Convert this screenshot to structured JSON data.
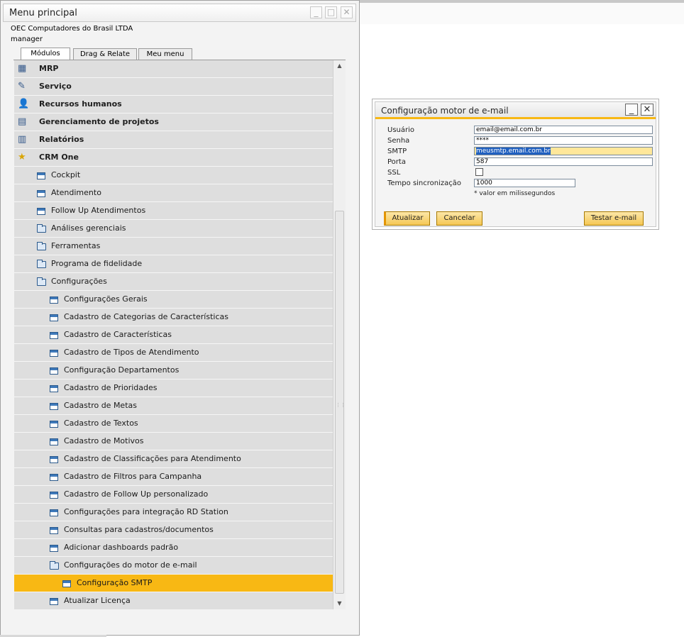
{
  "main_window": {
    "title": "Menu principal",
    "company": "OEC Computadores do Brasil LTDA",
    "user": "manager",
    "tabs": [
      {
        "label": "Módulos",
        "active": true
      },
      {
        "label": "Drag & Relate",
        "active": false
      },
      {
        "label": "Meu menu",
        "active": false
      }
    ],
    "controls": {
      "minimize": "_",
      "maximize": "□",
      "close": "✕"
    }
  },
  "tree": {
    "rows": [
      {
        "label": "MRP",
        "level": 0,
        "icon": "mrp-icon"
      },
      {
        "label": "Serviço",
        "level": 0,
        "icon": "service-icon"
      },
      {
        "label": "Recursos humanos",
        "level": 0,
        "icon": "human-resources-icon"
      },
      {
        "label": "Gerenciamento de projetos",
        "level": 0,
        "icon": "project-management-icon"
      },
      {
        "label": "Relatórios",
        "level": 0,
        "icon": "reports-icon"
      },
      {
        "label": "CRM One",
        "level": 0,
        "icon": "crm-one-icon"
      },
      {
        "label": "Cockpit",
        "level": 1,
        "icon": "window-icon"
      },
      {
        "label": "Atendimento",
        "level": 1,
        "icon": "window-icon"
      },
      {
        "label": "Follow Up Atendimentos",
        "level": 1,
        "icon": "window-icon"
      },
      {
        "label": "Análises gerenciais",
        "level": 1,
        "icon": "folder-icon"
      },
      {
        "label": "Ferramentas",
        "level": 1,
        "icon": "folder-icon"
      },
      {
        "label": "Programa de fidelidade",
        "level": 1,
        "icon": "folder-icon"
      },
      {
        "label": "Configurações",
        "level": 1,
        "icon": "folder-open-icon"
      },
      {
        "label": "Configurações Gerais",
        "level": 2,
        "icon": "window-icon"
      },
      {
        "label": "Cadastro de Categorias de Características",
        "level": 2,
        "icon": "window-icon"
      },
      {
        "label": "Cadastro de Características",
        "level": 2,
        "icon": "window-icon"
      },
      {
        "label": "Cadastro de Tipos de Atendimento",
        "level": 2,
        "icon": "window-icon"
      },
      {
        "label": "Configuração Departamentos",
        "level": 2,
        "icon": "window-icon"
      },
      {
        "label": "Cadastro de Prioridades",
        "level": 2,
        "icon": "window-icon"
      },
      {
        "label": "Cadastro de Metas",
        "level": 2,
        "icon": "window-icon"
      },
      {
        "label": "Cadastro de Textos",
        "level": 2,
        "icon": "window-icon"
      },
      {
        "label": "Cadastro de Motivos",
        "level": 2,
        "icon": "window-icon"
      },
      {
        "label": "Cadastro de Classificações para Atendimento",
        "level": 2,
        "icon": "window-icon"
      },
      {
        "label": "Cadastro de Filtros para Campanha",
        "level": 2,
        "icon": "window-icon"
      },
      {
        "label": "Cadastro de Follow Up personalizado",
        "level": 2,
        "icon": "window-icon"
      },
      {
        "label": "Configurações para integração RD Station",
        "level": 2,
        "icon": "window-icon"
      },
      {
        "label": "Consultas para cadastros/documentos",
        "level": 2,
        "icon": "window-icon"
      },
      {
        "label": "Adicionar dashboards padrão",
        "level": 2,
        "icon": "window-icon"
      },
      {
        "label": "Configurações do motor de e-mail",
        "level": 2,
        "icon": "folder-open-icon"
      },
      {
        "label": "Configuração SMTP",
        "level": 3,
        "icon": "window-icon",
        "selected": true
      },
      {
        "label": "Atualizar Licença",
        "level": 2,
        "icon": "window-icon"
      }
    ]
  },
  "dialog": {
    "title": "Configuração motor de e-mail",
    "controls": {
      "minimize": "_",
      "close": "✕"
    },
    "fields": {
      "usuario": {
        "label": "Usuário",
        "value": "email@email.com.br"
      },
      "senha": {
        "label": "Senha",
        "value": "****"
      },
      "smtp": {
        "label": "SMTP",
        "value": "meusmtp.email.com.br"
      },
      "porta": {
        "label": "Porta",
        "value": "587"
      },
      "ssl": {
        "label": "SSL",
        "checked": false
      },
      "tempo": {
        "label": "Tempo sincronização",
        "value": "1000"
      }
    },
    "note": "* valor em milissegundos",
    "buttons": {
      "update": "Atualizar",
      "cancel": "Cancelar",
      "test": "Testar e-mail"
    }
  },
  "colors": {
    "selection": "#f8b814",
    "tree_bg": "#dedede",
    "accent_blue": "#3e79ba"
  }
}
